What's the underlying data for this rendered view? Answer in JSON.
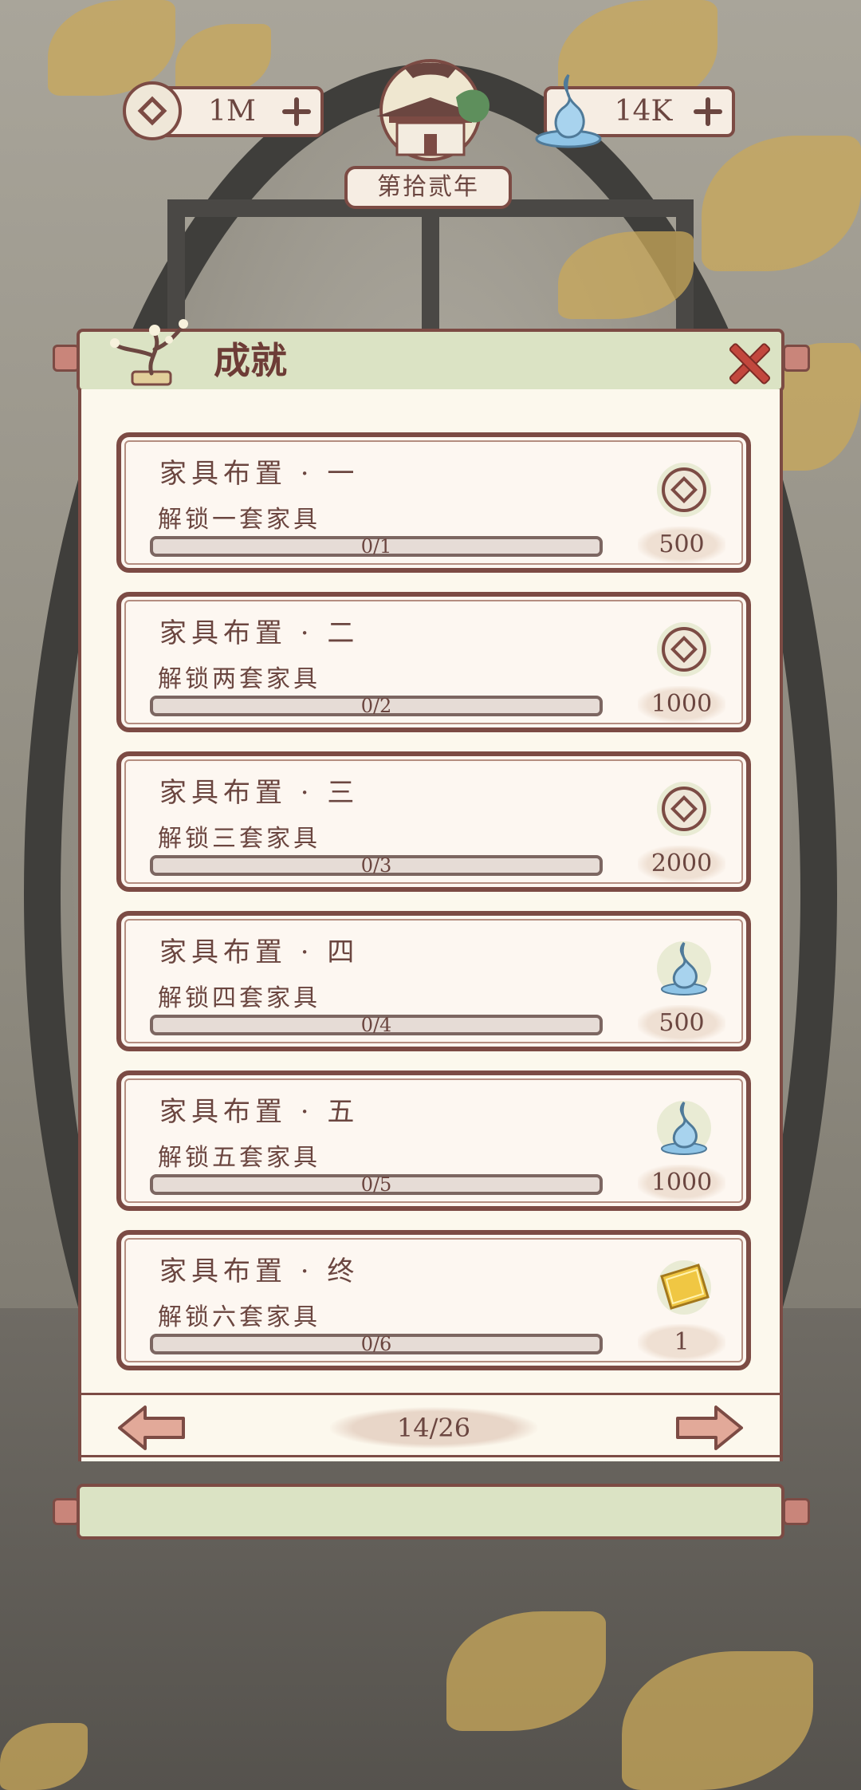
{
  "top_bar": {
    "coins": "1M",
    "water": "14K",
    "year": "第拾贰年"
  },
  "panel": {
    "title": "成就"
  },
  "achievements": [
    {
      "title": "家具布置 · 一",
      "desc": "解锁一套家具",
      "progress": "0/1",
      "progress_fraction": 0,
      "reward_icon": "coin-icon",
      "reward": "500"
    },
    {
      "title": "家具布置 · 二",
      "desc": "解锁两套家具",
      "progress": "0/2",
      "progress_fraction": 0,
      "reward_icon": "coin-icon",
      "reward": "1000"
    },
    {
      "title": "家具布置 · 三",
      "desc": "解锁三套家具",
      "progress": "0/3",
      "progress_fraction": 0,
      "reward_icon": "coin-icon",
      "reward": "2000"
    },
    {
      "title": "家具布置 · 四",
      "desc": "解锁四套家具",
      "progress": "0/4",
      "progress_fraction": 0,
      "reward_icon": "water-drop-icon",
      "reward": "500"
    },
    {
      "title": "家具布置 · 五",
      "desc": "解锁五套家具",
      "progress": "0/5",
      "progress_fraction": 0,
      "reward_icon": "water-drop-icon",
      "reward": "1000"
    },
    {
      "title": "家具布置 · 终",
      "desc": "解锁六套家具",
      "progress": "0/6",
      "progress_fraction": 0,
      "reward_icon": "golden-ticket-icon",
      "reward": "1"
    }
  ],
  "pagination": {
    "page": "14/26"
  },
  "colors": {
    "border": "#7c4b44",
    "text": "#6b4640",
    "header_bg": "#dbe3c4",
    "panel_bg": "#fcf8ed",
    "close": "#c2473d",
    "water": "#8fc4e6",
    "ticket": "#e8b735"
  }
}
